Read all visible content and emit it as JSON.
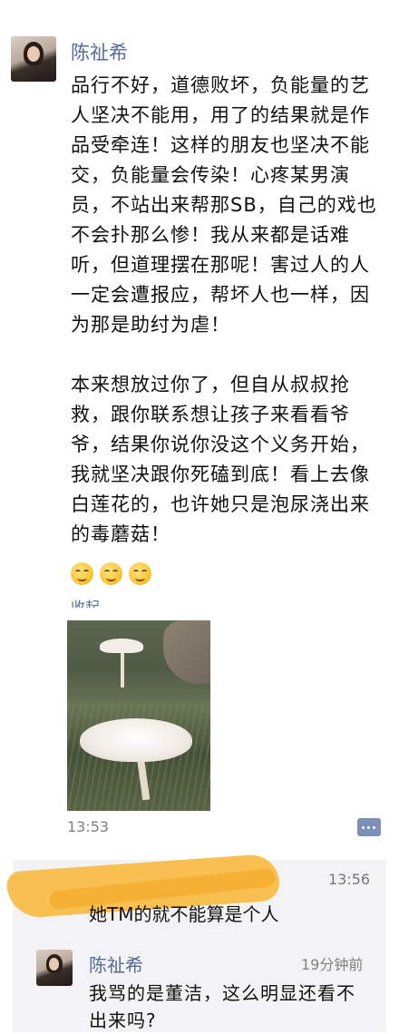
{
  "post": {
    "author": "陈祉希",
    "paragraph1": "品行不好，道德败坏，负能量的艺人坚决不能用，用了的结果就是作品受牵连！这样的朋友也坚决不能交，负能量会传染！心疼某男演员，不站出来帮那SB，自己的戏也不会扑那么惨！我从来都是话难听，但道理摆在那呢！害过人的人一定会遭报应，帮坏人也一样，因为那是助纣为虐！",
    "paragraph2": "本来想放过你了，但自从叔叔抢救，跟你联系想让孩子来看看爷爷，结果你说你没这个义务开始，我就坚决跟你死磕到底！看上去像白莲花的，也许她只是泡尿浇出来的毒蘑菇！",
    "emoji_icon": "grin-emoji-icon",
    "emoji_count": 3,
    "collapse_label": "收起",
    "photo_icon": "mushroom-photo",
    "time": "13:53",
    "comment_icon": "comment-dots-icon"
  },
  "comments": [
    {
      "time": "13:56",
      "text": "她TM的就不能算是个人"
    },
    {
      "author": "陈祉希",
      "time": "19分钟前",
      "text": "我骂的是董洁，这么明显还看不出来吗?"
    }
  ],
  "colors": {
    "name_link": "#576b95",
    "comment_bg": "#f3f3f5",
    "scribble": "#f8bd47"
  }
}
